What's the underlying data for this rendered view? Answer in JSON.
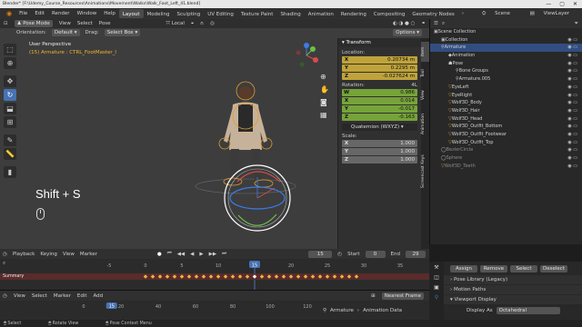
{
  "window": {
    "title": "Blender* [F:\\Udemy_Course_Resources\\Animations\\Movement\\Walks\\Walk_Foot_Left_41.blend]",
    "controls": [
      "—",
      "▢",
      "✕"
    ]
  },
  "menubar": {
    "menus": [
      "File",
      "Edit",
      "Render",
      "Window",
      "Help"
    ],
    "workspaces": [
      "Layout",
      "Modeling",
      "Sculpting",
      "UV Editing",
      "Texture Paint",
      "Shading",
      "Animation",
      "Rendering",
      "Compositing",
      "Geometry Nodes"
    ],
    "active_workspace": "Layout",
    "scene": "Scene",
    "view_layer": "ViewLayer"
  },
  "viewport": {
    "mode": "Pose Mode",
    "menus": [
      "View",
      "Select",
      "Pose"
    ],
    "pivot": "Local",
    "orientation_label": "Orientation:",
    "orientation": "Default",
    "drag_label": "Drag:",
    "drag": "Select Box",
    "options": "Options",
    "perspective": "User Perspective",
    "selection": "(15) Armature : CTRL_FootMaster_l",
    "overlay_key": "Shift + S"
  },
  "transform_panel": {
    "header": "Transform",
    "location_label": "Location:",
    "location": [
      {
        "k": "X",
        "v": "0.20734 m"
      },
      {
        "k": "Y",
        "v": "0.2295 m"
      },
      {
        "k": "Z",
        "v": "-0.027624 m"
      }
    ],
    "rotation_label": "Rotation:",
    "rotation_lock": "4L",
    "rotation": [
      {
        "k": "W",
        "v": "0.986"
      },
      {
        "k": "X",
        "v": "0.014"
      },
      {
        "k": "Y",
        "v": "-0.017"
      },
      {
        "k": "Z",
        "v": "-0.163"
      }
    ],
    "rotation_mode": "Quaternion (WXYZ)",
    "scale_label": "Scale:",
    "scale": [
      {
        "k": "X",
        "v": "1.000"
      },
      {
        "k": "Y",
        "v": "1.000"
      },
      {
        "k": "Z",
        "v": "1.000"
      }
    ],
    "side_tabs": [
      "Item",
      "Tool",
      "View",
      "Animation",
      "Screencast Keys"
    ]
  },
  "outliner": {
    "rows": [
      {
        "label": "Scene Collection",
        "indent": 0,
        "icon": "▣"
      },
      {
        "label": "Collection",
        "indent": 1,
        "icon": "▣"
      },
      {
        "label": "Armature",
        "indent": 1,
        "icon": "⚲",
        "selected": true
      },
      {
        "label": "Animation",
        "indent": 2,
        "icon": "◆"
      },
      {
        "label": "Pose",
        "indent": 2,
        "icon": "☗"
      },
      {
        "label": "Bone Groups",
        "indent": 3,
        "icon": "⚲"
      },
      {
        "label": "Armature.005",
        "indent": 3,
        "icon": "⚲"
      },
      {
        "label": "EyeLeft",
        "indent": 2,
        "icon": "▽"
      },
      {
        "label": "EyeRight",
        "indent": 2,
        "icon": "▽"
      },
      {
        "label": "Wolf3D_Body",
        "indent": 2,
        "icon": "▽"
      },
      {
        "label": "Wolf3D_Hair",
        "indent": 2,
        "icon": "▽"
      },
      {
        "label": "Wolf3D_Head",
        "indent": 2,
        "icon": "▽"
      },
      {
        "label": "Wolf3D_Outfit_Bottom",
        "indent": 2,
        "icon": "▽"
      },
      {
        "label": "Wolf3D_Outfit_Footwear",
        "indent": 2,
        "icon": "▽"
      },
      {
        "label": "Wolf3D_Outfit_Top",
        "indent": 2,
        "icon": "▽"
      },
      {
        "label": "BezierCircle",
        "indent": 1,
        "icon": "◯",
        "dim": true
      },
      {
        "label": "Sphere",
        "indent": 1,
        "icon": "◯",
        "dim": true
      },
      {
        "label": "Wolf3D_Teeth",
        "indent": 1,
        "icon": "▽",
        "dim": true
      }
    ]
  },
  "properties": {
    "buttons": [
      "Assign",
      "Remove",
      "Select",
      "Deselect"
    ],
    "sections": [
      "Pose Library (Legacy)",
      "Motion Paths",
      "Viewport Display"
    ],
    "display_as_label": "Display As",
    "display_as": "Octahedral"
  },
  "timeline": {
    "menus": [
      "Playback",
      "Keying",
      "View",
      "Marker"
    ],
    "current_frame": "15",
    "start_label": "Start",
    "start": "0",
    "end_label": "End",
    "end": "29",
    "ticks": [
      "-5",
      "0",
      "5",
      "10",
      "15",
      "20",
      "25",
      "30",
      "35"
    ],
    "summary": "Summary",
    "keyframes": [
      0,
      1,
      2,
      3,
      4,
      5,
      6,
      7,
      8,
      9,
      10,
      11,
      12,
      13,
      14,
      15,
      16,
      17,
      18,
      19,
      20,
      21,
      22,
      23,
      24,
      25,
      26,
      27,
      28,
      29
    ]
  },
  "action_editor": {
    "menus": [
      "View",
      "Select",
      "Marker",
      "Edit",
      "Add"
    ],
    "ticks": [
      "0",
      "20",
      "40",
      "60",
      "80",
      "100",
      "120"
    ],
    "frame_box": "15",
    "snap": "Nearest Frame",
    "object": "Armature",
    "data": "Animation Data"
  },
  "statusbar": {
    "items": [
      "Select",
      "Rotate View",
      "Pose Context Menu"
    ]
  },
  "colors": {
    "accent": "#4772b3",
    "selected_text": "#f2b731",
    "location_field": "#bfa33a",
    "rotation_field": "#76a33a"
  }
}
